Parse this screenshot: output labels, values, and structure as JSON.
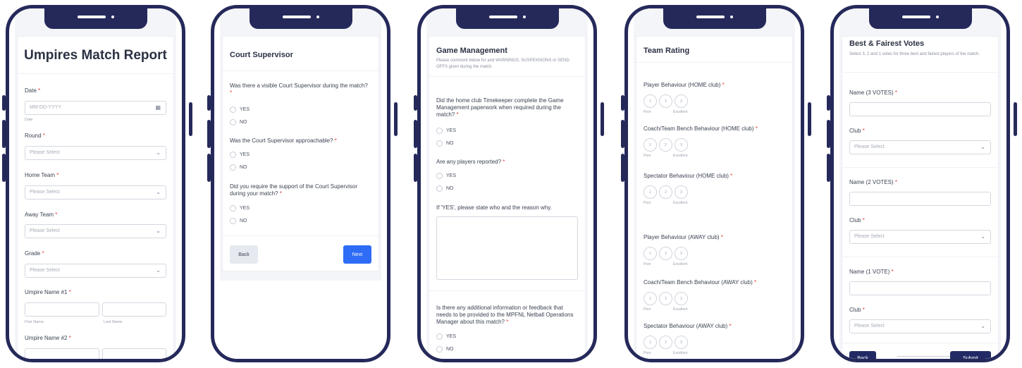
{
  "colors": {
    "frame": "#25295a",
    "accent_blue": "#2f6cf6",
    "navy_button": "#222a66",
    "required": "#e23d3d"
  },
  "icons": {
    "calendar": "calendar-icon",
    "dropdown": "chevron-down-icon"
  },
  "screen1": {
    "title": "Umpires Match Report",
    "date_label": "Date",
    "date_placeholder": "MM-DD-YYYY",
    "date_sublabel": "Date",
    "round_label": "Round",
    "home_team_label": "Home Team",
    "away_team_label": "Away Team",
    "grade_label": "Grade",
    "select_placeholder": "Please Select",
    "umpire1_label": "Umpire Name #1",
    "umpire2_label": "Umpire Name #2",
    "first_name": "First Name",
    "last_name": "Last Name",
    "required_mark": "*"
  },
  "screen2": {
    "title": "Court Supervisor",
    "q1": "Was there a visible Court Supervisor during the match?",
    "q2": "Was the Court Supervisor approachable?",
    "q3": "Did you require the support of the Court Supervisor during your match?",
    "yes": "YES",
    "no": "NO",
    "back": "Back",
    "next": "Next",
    "required_mark": "*"
  },
  "screen3": {
    "title": "Game Management",
    "description": "Please comment below for and WARNINGS, SUSPENSIONS or SEND OFFS given during the match.",
    "q1": "Did the home club Timekeeper complete the Game Management paperwork when required during the match?",
    "q2": "Are any players reported?",
    "q3": "If 'YES', please state who and the reason why.",
    "q4": "Is there any additional information or feedback that needs to be provided to the MPFNL Netball Operations Manager about this match?",
    "yes": "YES",
    "no": "NO",
    "required_mark": "*"
  },
  "screen4": {
    "title": "Team Rating",
    "items": [
      "Player Behaviour (HOME club)",
      "Coach/Team Bench Behaviour (HOME club)",
      "Spectator Behaviour (HOME club)",
      "Player Behaviour (AWAY club)",
      "Coach/Team Bench Behaviour (AWAY club)",
      "Spectator Behaviour (AWAY club)"
    ],
    "scale": [
      "1",
      "2",
      "3"
    ],
    "poor": "Poor",
    "excellent": "Excellent",
    "required_mark": "*"
  },
  "screen5": {
    "title": "Best & Fairest Votes",
    "description": "Select 3, 2 and 1 votes for three best and fairest players of the match.",
    "name3": "Name (3 VOTES)",
    "name2": "Name (2 VOTES)",
    "name1": "Name (1 VOTE)",
    "club": "Club",
    "select_placeholder": "Please Select",
    "back": "Back",
    "submit": "Submit",
    "required_mark": "*"
  }
}
